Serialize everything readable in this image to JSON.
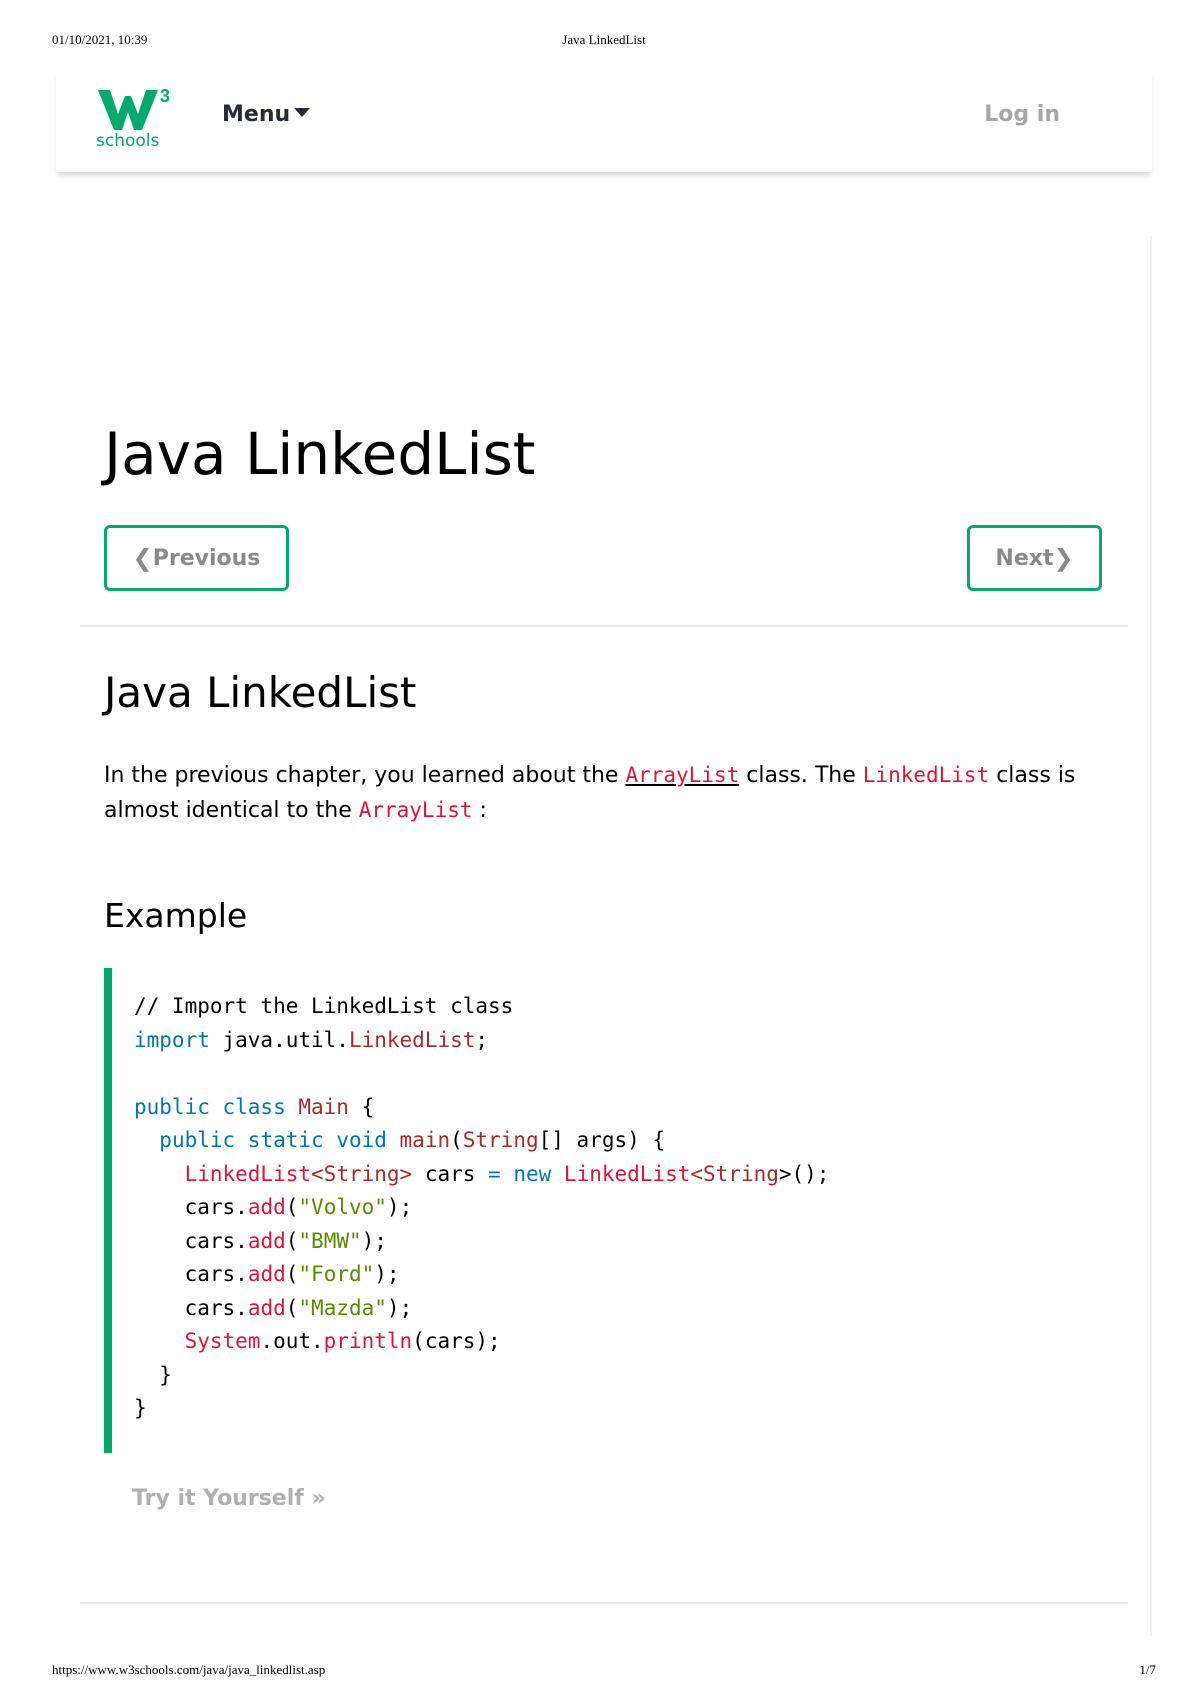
{
  "print_header": {
    "datetime": "01/10/2021, 10:39",
    "doc_title": "Java LinkedList"
  },
  "print_footer": {
    "url": "https://www.w3schools.com/java/java_linkedlist.asp",
    "page": "1/7"
  },
  "navbar": {
    "logo_superscript": "3",
    "logo_text": "schools",
    "menu_label": "Menu",
    "login_label": "Log in"
  },
  "page": {
    "title": "Java LinkedList",
    "prev_label": "Previous",
    "next_label": "Next",
    "section_title": "Java LinkedList",
    "intro": {
      "part1": "In the previous chapter, you learned about the ",
      "code1": "ArrayList",
      "part2": " class. The ",
      "code2": "LinkedList",
      "part3": " class is almost identical to the ",
      "code3": "ArrayList",
      "part4": " :"
    },
    "example_title": "Example",
    "try_label": "Try it Yourself »"
  },
  "code": {
    "l1_comment": "// Import the LinkedList class",
    "l2_import": "import",
    "l2_pkg": " java.util.",
    "l2_cls": "LinkedList",
    "l2_end": ";",
    "l4_public": "public",
    "l4_class": " class",
    "l4_name": " Main",
    "l4_brace": " {",
    "l5_public": "public",
    "l5_static": " static",
    "l5_void": " void",
    "l5_main": " main",
    "l5_p1": "(",
    "l5_string": "String",
    "l5_rest": "[] args) {",
    "l6_cls": "LinkedList",
    "l6_lt": "<",
    "l6_string": "String",
    "l6_gt": ">",
    "l6_var": " cars",
    "l6_eq": " =",
    "l6_new": " new",
    "l6_cls2": " LinkedList",
    "l6_lt2": "<",
    "l6_string2": "String",
    "l6_end": ">();",
    "cars": "cars",
    "dot": ".",
    "add": "add",
    "open": "(",
    "close": ");",
    "s_volvo": "\"Volvo\"",
    "s_bmw": "\"BMW\"",
    "s_ford": "\"Ford\"",
    "s_mazda": "\"Mazda\"",
    "l11_system": "System",
    "l11_out": ".out.",
    "l11_println": "println",
    "l11_args": "(cars);",
    "close_brace": "}"
  },
  "colors": {
    "accent_green": "#04aa6d",
    "code_red": "#dc143c",
    "keyword_blue": "#0077aa"
  }
}
